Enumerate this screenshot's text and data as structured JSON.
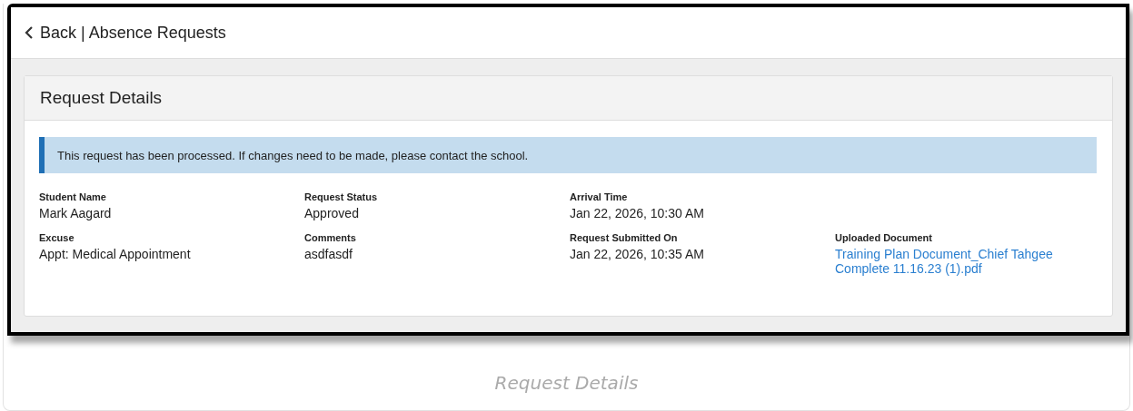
{
  "header": {
    "back_link": "Back | Absence Requests"
  },
  "card": {
    "title": "Request Details",
    "notice": "This request has been processed. If changes need to be made, please contact the school.",
    "field_rows": [
      [
        {
          "label": "Student Name",
          "value": "Mark Aagard",
          "kind": "text"
        },
        {
          "label": "Request Status",
          "value": "Approved",
          "kind": "text"
        },
        {
          "label": "Arrival Time",
          "value": "Jan 22, 2026, 10:30 AM",
          "kind": "text"
        }
      ],
      [
        {
          "label": "Excuse",
          "value": "Appt: Medical Appointment",
          "kind": "text"
        },
        {
          "label": "Comments",
          "value": "asdfasdf",
          "kind": "text"
        },
        {
          "label": "Request Submitted On",
          "value": "Jan 22, 2026, 10:35 AM",
          "kind": "text"
        },
        {
          "label": "Uploaded Document",
          "value": "Training Plan Document_Chief Tahgee Complete 11.16.23 (1).pdf",
          "kind": "link"
        }
      ]
    ]
  },
  "caption": "Request Details"
}
